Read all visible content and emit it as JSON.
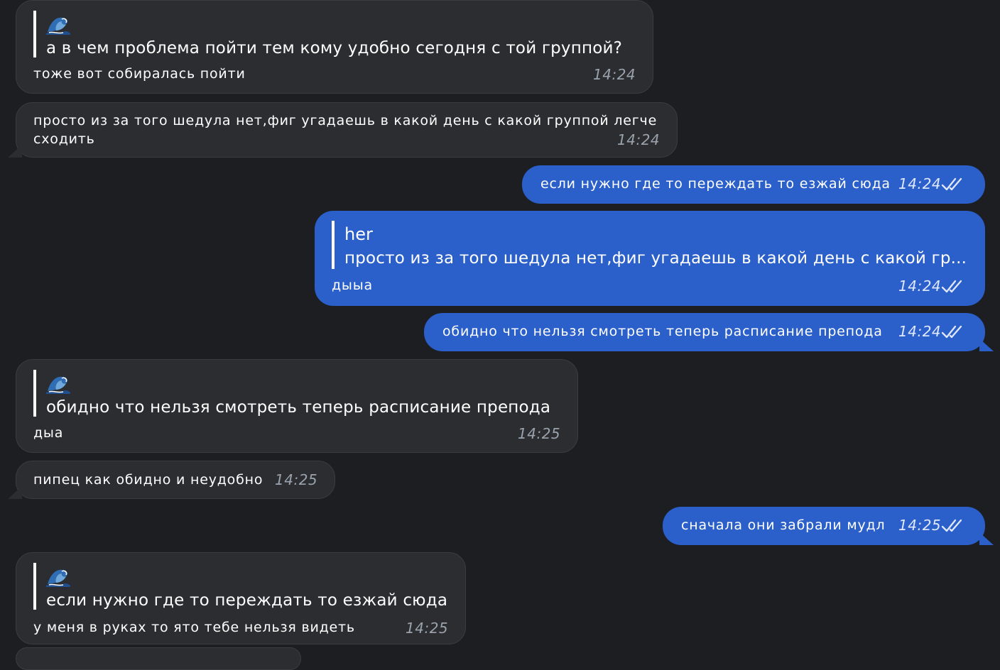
{
  "messages": [
    {
      "reply_author_icon": "wave-emoji-icon",
      "reply_text": "а в чем проблема пойти тем кому удобно сегодня с той группой?",
      "text": "тоже вот собиралась пойти",
      "time": "14:24"
    },
    {
      "text": "просто из за того шедула нет,фиг угадаешь в какой день с какой группой легче",
      "text_line2": "сходить",
      "time": "14:24"
    },
    {
      "text": "если нужно где то переждать то езжай сюда",
      "time": "14:24"
    },
    {
      "reply_author": "her",
      "reply_text": "просто из за того шедула нет,фиг угадаешь в какой день с какой гр...",
      "text": "дыыа",
      "time": "14:24"
    },
    {
      "text": "обидно что нельзя смотреть теперь расписание препода",
      "time": "14:24"
    },
    {
      "reply_author_icon": "wave-emoji-icon",
      "reply_text": "обидно что нельзя смотреть теперь расписание препода",
      "text": "дыа",
      "time": "14:25"
    },
    {
      "text": "пипец как обидно и неудобно",
      "time": "14:25"
    },
    {
      "text": "сначала они забрали мудл",
      "time": "14:25"
    },
    {
      "reply_author_icon": "wave-emoji-icon",
      "reply_text": "если нужно где то переждать то езжай сюда",
      "text": "у меня в руках то ято тебе нельзя видеть",
      "time": "14:25"
    }
  ],
  "colors": {
    "background": "#1c1e22",
    "incoming": "#2c2d30",
    "outgoing": "#2b5fc9",
    "time_in": "#9aa3ad",
    "time_out": "#dfe8ff"
  }
}
